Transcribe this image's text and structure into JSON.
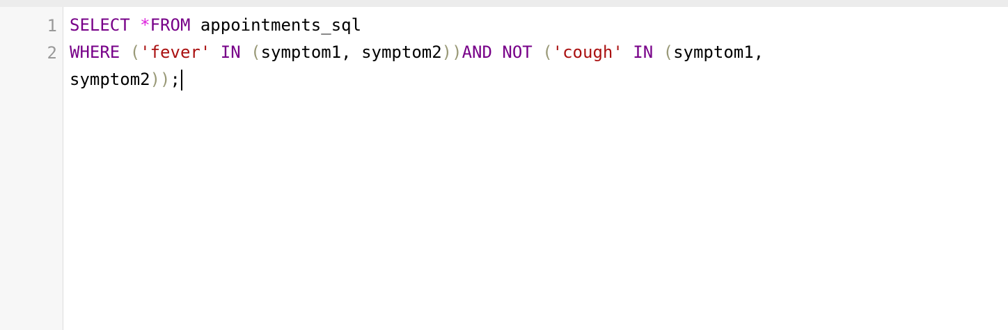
{
  "editor": {
    "gutter": {
      "line_numbers": [
        "1",
        "2"
      ]
    },
    "lines": [
      {
        "tokens": [
          {
            "text": "SELECT",
            "kind": "keyword"
          },
          {
            "text": " ",
            "kind": "plain"
          },
          {
            "text": "*",
            "kind": "operator"
          },
          {
            "text": "FROM",
            "kind": "keyword"
          },
          {
            "text": " appointments_sql",
            "kind": "plain"
          }
        ]
      },
      {
        "tokens": [
          {
            "text": "WHERE",
            "kind": "keyword"
          },
          {
            "text": " ",
            "kind": "plain"
          },
          {
            "text": "(",
            "kind": "bracket"
          },
          {
            "text": "'fever'",
            "kind": "string"
          },
          {
            "text": " ",
            "kind": "plain"
          },
          {
            "text": "IN",
            "kind": "keyword"
          },
          {
            "text": " ",
            "kind": "plain"
          },
          {
            "text": "(",
            "kind": "bracket"
          },
          {
            "text": "symptom1, symptom2",
            "kind": "plain"
          },
          {
            "text": "))",
            "kind": "bracket"
          },
          {
            "text": "AND",
            "kind": "keyword"
          },
          {
            "text": " ",
            "kind": "plain"
          },
          {
            "text": "NOT",
            "kind": "keyword"
          },
          {
            "text": " ",
            "kind": "plain"
          },
          {
            "text": "(",
            "kind": "bracket"
          },
          {
            "text": "'cough'",
            "kind": "string"
          },
          {
            "text": " ",
            "kind": "plain"
          },
          {
            "text": "IN",
            "kind": "keyword"
          },
          {
            "text": " ",
            "kind": "plain"
          },
          {
            "text": "(",
            "kind": "bracket"
          },
          {
            "text": "symptom1,",
            "kind": "plain"
          }
        ]
      },
      {
        "tokens": [
          {
            "text": "symptom2",
            "kind": "plain"
          },
          {
            "text": "))",
            "kind": "bracket"
          },
          {
            "text": ";",
            "kind": "plain"
          }
        ]
      }
    ],
    "colors": {
      "keyword": "#770088",
      "operator": "#dd22dd",
      "string": "#aa1111",
      "bracket": "#999977",
      "plain": "#000000",
      "line_number": "#999999",
      "gutter_background": "#f7f7f7"
    }
  }
}
